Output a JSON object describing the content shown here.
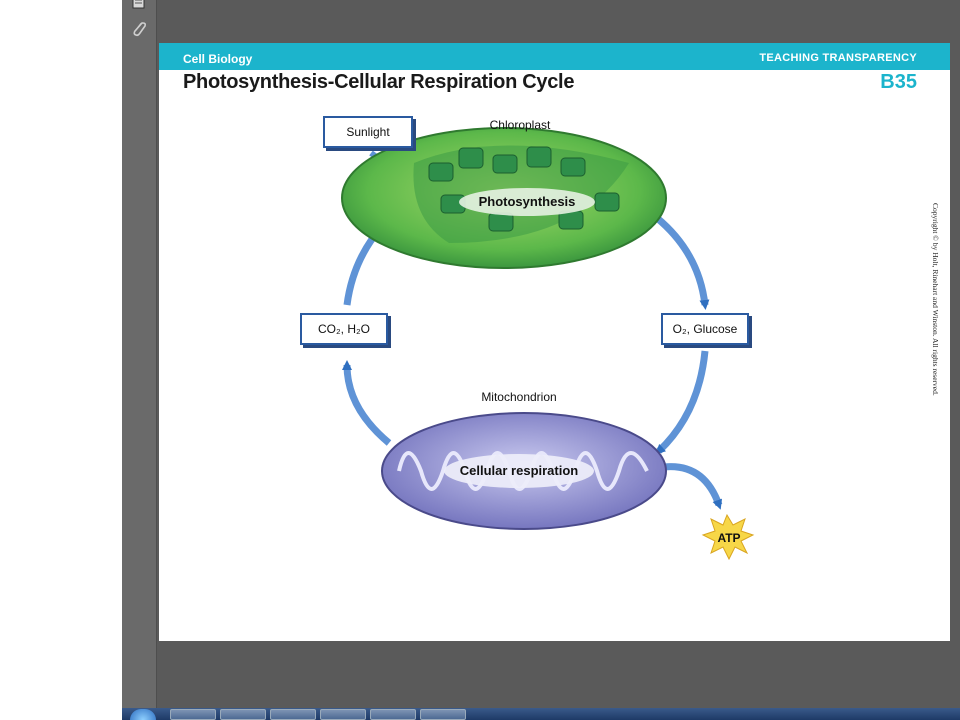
{
  "page": {
    "banner_left": "Cell Biology",
    "banner_right": "TEACHING TRANSPARENCY",
    "title": "Photosynthesis-Cellular Respiration Cycle",
    "code": "B35",
    "copyright": "Copyright © by Holt, Rinehart and Winston. All rights reserved."
  },
  "diagram": {
    "sunlight": "Sunlight",
    "chloroplast_label": "Chloroplast",
    "photosynthesis": "Photosynthesis",
    "outputs_label": "O₂, Glucose",
    "inputs_label": "CO₂, H₂O",
    "mitochondrion_label": "Mitochondrion",
    "respiration": "Cellular respiration",
    "atp": "ATP"
  },
  "colors": {
    "banner": "#1cb4cc",
    "arrow": "#2f6fc0",
    "chloroplast": "#56b848",
    "mitochondrion": "#8e8ed0"
  },
  "icons": [
    "page-icon",
    "paperclip-icon",
    "start-orb-icon"
  ]
}
